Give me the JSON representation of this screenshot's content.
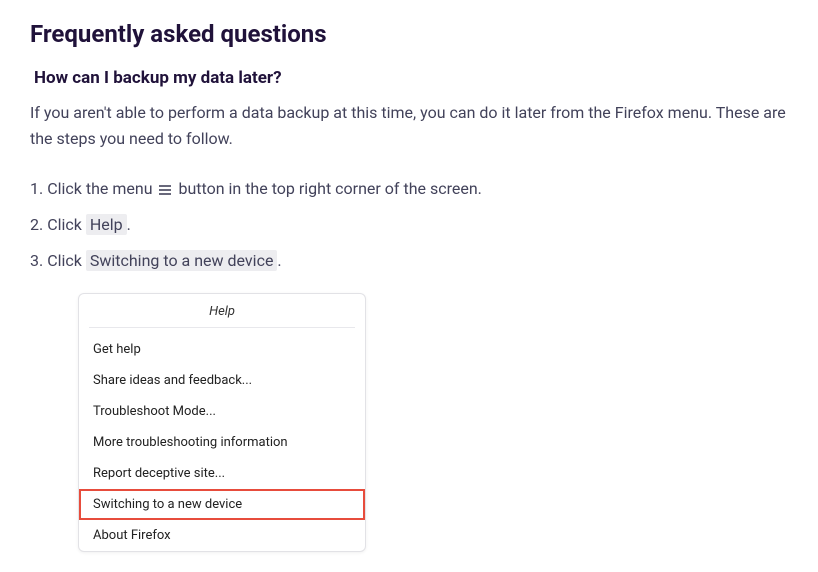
{
  "heading": "Frequently asked questions",
  "question": "How can I backup my data later?",
  "intro": "If you aren't able to perform a data backup at this time, you can do it later from the Firefox menu. These are the steps you need to follow.",
  "steps": {
    "s1_pre": "Click the menu ",
    "s1_post": " button in the top right corner of the screen.",
    "s2_pre": "Click ",
    "s2_pill": "Help",
    "s2_post": ".",
    "s3_pre": "Click ",
    "s3_pill": "Switching to a new device",
    "s3_post": "."
  },
  "menu": {
    "title": "Help",
    "items": [
      "Get help",
      "Share ideas and feedback...",
      "Troubleshoot Mode...",
      "More troubleshooting information",
      "Report deceptive site...",
      "Switching to a new device",
      "About Firefox"
    ],
    "highlight_index": 5
  }
}
